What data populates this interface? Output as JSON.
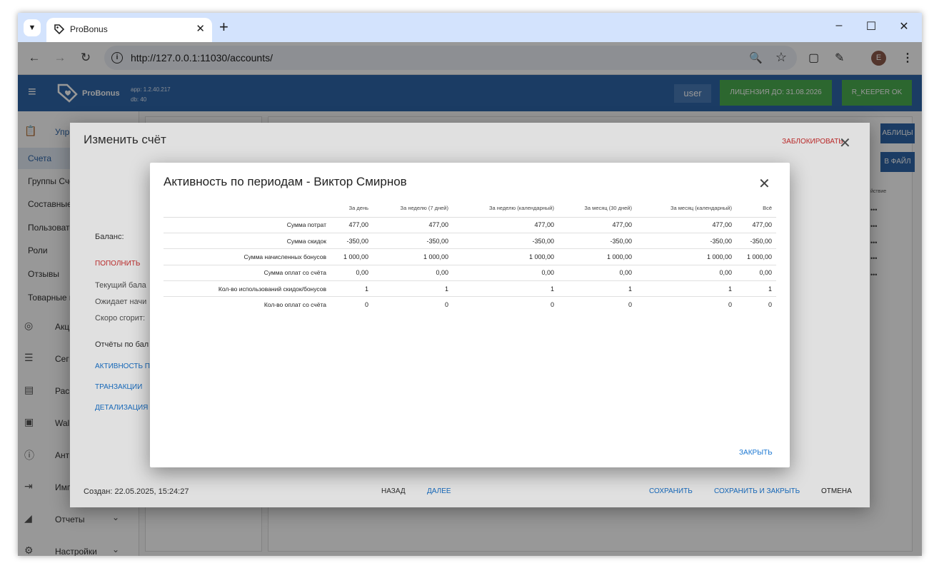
{
  "browser": {
    "tab_title": "ProBonus",
    "url": "http://127.0.0.1:11030/accounts/",
    "profile_initial": "E",
    "window_controls": [
      "–",
      "☐",
      "✕"
    ]
  },
  "appbar": {
    "brand": "ProBonus",
    "version_app": "app: 1.2.40.217",
    "version_db": "db: 40",
    "user_label": "user",
    "license_label": "ЛИЦЕНЗИЯ ДО: 31.08.2026",
    "rkeeper_label": "R_KEEPER OK",
    "colors": {
      "appbar": "#2f66a8",
      "status_ok": "#4caf50"
    }
  },
  "sidebar": {
    "section_label": "Упр",
    "items": [
      {
        "label": "Счета",
        "active": true
      },
      {
        "label": "Группы Сче"
      },
      {
        "label": "Составные"
      },
      {
        "label": "Пользовате"
      },
      {
        "label": "Роли"
      },
      {
        "label": "Отзывы"
      },
      {
        "label": "Товарные к"
      }
    ],
    "groups": [
      {
        "label": "Акц",
        "icon": "eye-icon"
      },
      {
        "label": "Сег",
        "icon": "segments-icon"
      },
      {
        "label": "Рас",
        "icon": "mailing-icon"
      },
      {
        "label": "Wall",
        "icon": "wallet-icon"
      },
      {
        "label": "Анти",
        "icon": "alert-icon"
      },
      {
        "label": "Имп",
        "icon": "import-icon"
      },
      {
        "label": "Отчеты",
        "icon": "chart-icon"
      },
      {
        "label": "Настройки",
        "icon": "gear-icon"
      }
    ]
  },
  "background_page": {
    "btn_tables": "АБЛИЦЫ",
    "btn_file": "В ФАЙЛ",
    "col_action": "йствие",
    "row_menu": "•••"
  },
  "edit_dialog": {
    "title": "Изменить счёт",
    "block_label": "ЗАБЛОКИРОВАТЬ",
    "balance_label": "Баланс:",
    "topup_label": "ПОПОЛНИТЬ",
    "current_balance": "Текущий бала",
    "pending": "Ожидает начи",
    "expiring": "Скоро сгорит:",
    "reports_label": "Отчёты по бал",
    "link_activity": "АКТИВНОСТЬ П",
    "link_transactions": "ТРАНЗАКЦИИ",
    "link_details": "ДЕТАЛИЗАЦИЯ",
    "created": "Создан: 22.05.2025, 15:24:27",
    "back_label": "НАЗАД",
    "next_label": "ДАЛЕЕ",
    "save_label": "СОХРАНИТЬ",
    "save_close_label": "СОХРАНИТЬ И ЗАКРЫТЬ",
    "cancel_label": "ОТМЕНА"
  },
  "activity_dialog": {
    "title": "Активность по периодам - Виктор Смирнов",
    "close_label": "ЗАКРЫТЬ",
    "columns": [
      "",
      "За день",
      "За неделю (7 дней)",
      "За неделю (календарный)",
      "За месяц (30 дней)",
      "За месяц (календарный)",
      "Всё"
    ],
    "rows": [
      [
        "Сумма потрат",
        "477,00",
        "477,00",
        "477,00",
        "477,00",
        "477,00",
        "477,00"
      ],
      [
        "Сумма скидок",
        "-350,00",
        "-350,00",
        "-350,00",
        "-350,00",
        "-350,00",
        "-350,00"
      ],
      [
        "Сумма начисленных бонусов",
        "1 000,00",
        "1 000,00",
        "1 000,00",
        "1 000,00",
        "1 000,00",
        "1 000,00"
      ],
      [
        "Сумма оплат со счёта",
        "0,00",
        "0,00",
        "0,00",
        "0,00",
        "0,00",
        "0,00"
      ],
      [
        "Кол-во использований скидок/бонусов",
        "1",
        "1",
        "1",
        "1",
        "1",
        "1"
      ],
      [
        "Кол-во оплат со счёта",
        "0",
        "0",
        "0",
        "0",
        "0",
        "0"
      ]
    ]
  }
}
